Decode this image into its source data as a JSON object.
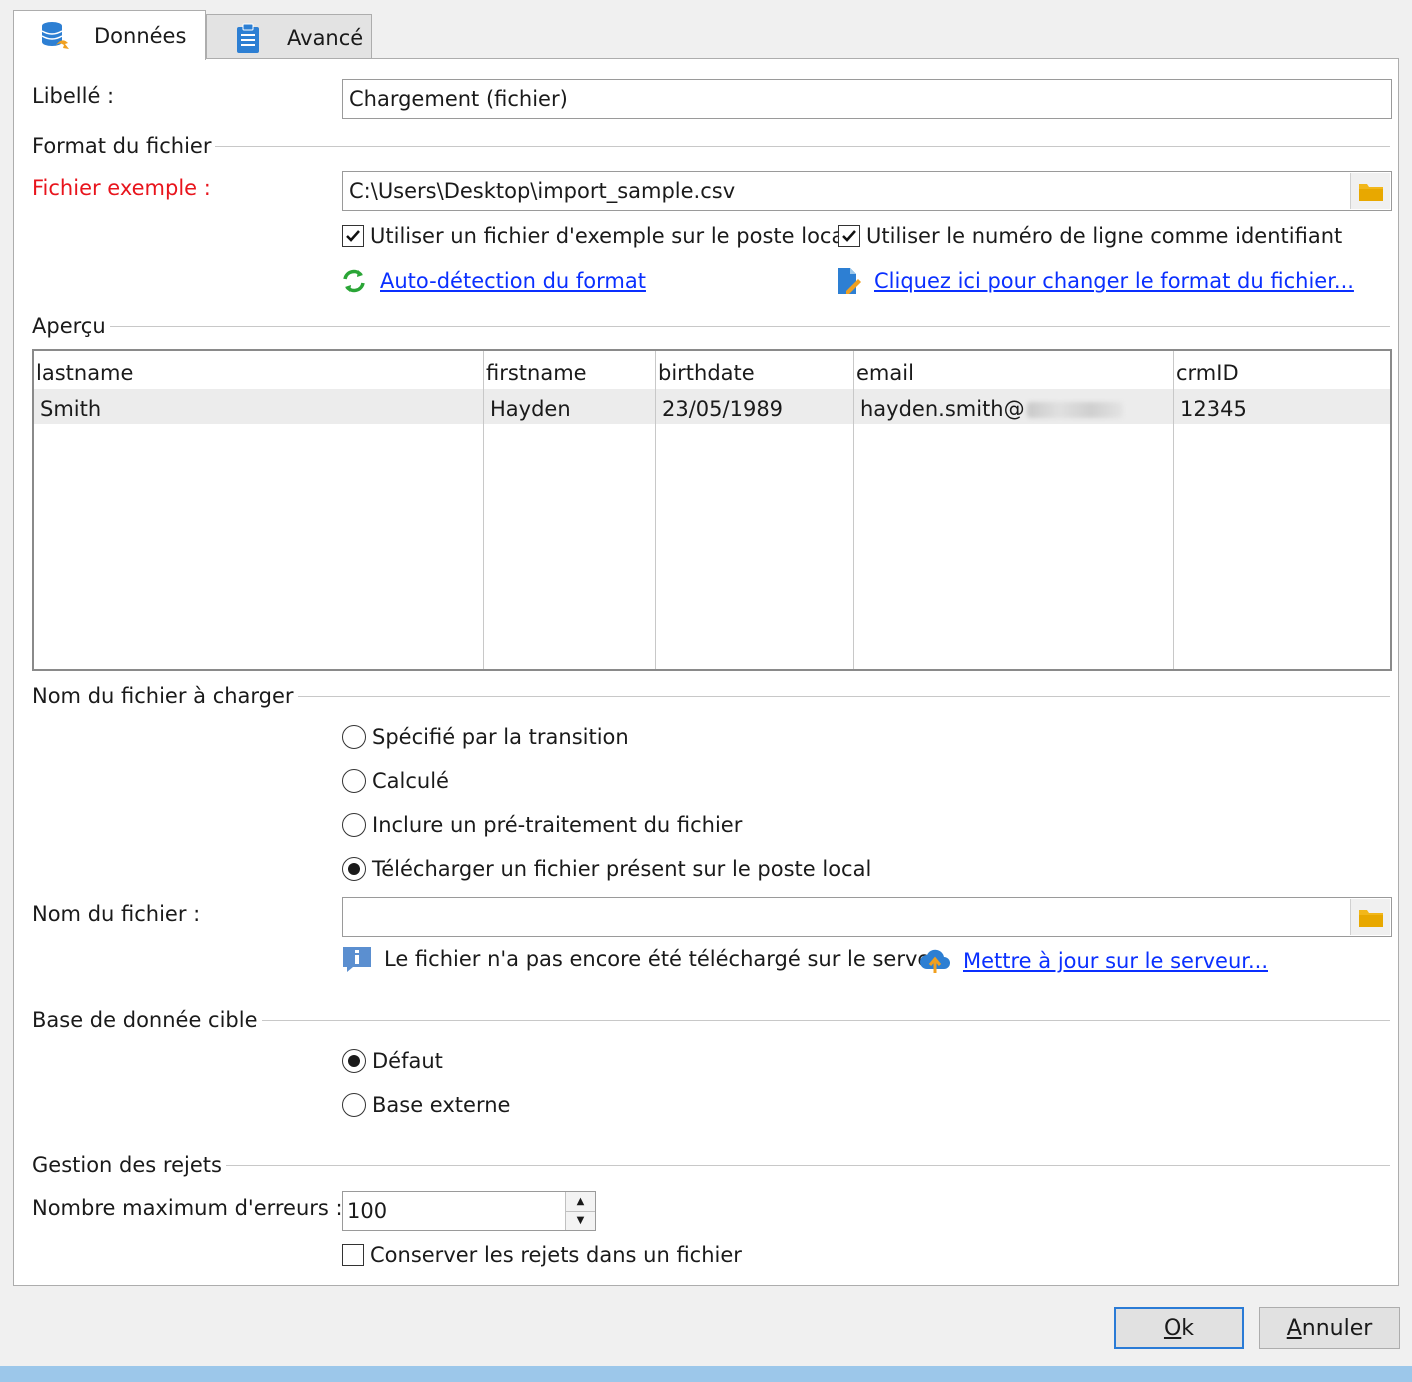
{
  "tabs": [
    {
      "label": "Données",
      "icon": "database-icon",
      "active": true
    },
    {
      "label": "Avancé",
      "icon": "clipboard-icon",
      "active": false
    }
  ],
  "libelle": {
    "label": "Libellé :",
    "value": "Chargement (fichier)"
  },
  "file_format": {
    "section": "Format du fichier",
    "sample_label": "Fichier exemple :",
    "sample_value": "C:\\Users\\Desktop\\import_sample.csv",
    "use_local_sample": {
      "label": "Utiliser un fichier d'exemple sur le poste local",
      "checked": true
    },
    "use_line_number": {
      "label": "Utiliser le numéro de ligne comme identifiant",
      "checked": true
    },
    "autodetect_link": "Auto-détection du format",
    "change_format_link": "Cliquez ici pour changer le format du fichier..."
  },
  "preview": {
    "section": "Aperçu",
    "columns": [
      "lastname",
      "firstname",
      "birthdate",
      "email",
      "crmID"
    ],
    "rows": [
      [
        "Smith",
        "Hayden",
        "23/05/1989",
        "hayden.smith@",
        "12345"
      ]
    ]
  },
  "filename_section": {
    "section": "Nom du fichier à charger",
    "options": [
      {
        "label": "Spécifié par la transition",
        "selected": false
      },
      {
        "label": "Calculé",
        "selected": false
      },
      {
        "label": "Inclure un pré-traitement du fichier",
        "selected": false
      },
      {
        "label": "Télécharger un fichier présent sur le poste local",
        "selected": true
      }
    ],
    "file_label": "Nom du fichier :",
    "file_value": "",
    "info_text": "Le fichier n'a pas encore été téléchargé sur le serveu",
    "upload_link": "Mettre à jour sur le serveur..."
  },
  "target_db": {
    "section": "Base de donnée cible",
    "options": [
      {
        "label": "Défaut",
        "selected": true
      },
      {
        "label": "Base externe",
        "selected": false
      }
    ]
  },
  "rejects": {
    "section": "Gestion des rejets",
    "max_errors_label": "Nombre maximum d'erreurs :",
    "max_errors_value": "100",
    "keep_rejects": {
      "label": "Conserver les rejets dans un fichier",
      "checked": false
    }
  },
  "buttons": {
    "ok_first": "O",
    "ok_rest": "k",
    "cancel_first": "A",
    "cancel_rest": "nnuler"
  },
  "colors": {
    "link": "#0a2fff",
    "required_label": "#e8141c",
    "default_button_border": "#2a7bd6"
  }
}
